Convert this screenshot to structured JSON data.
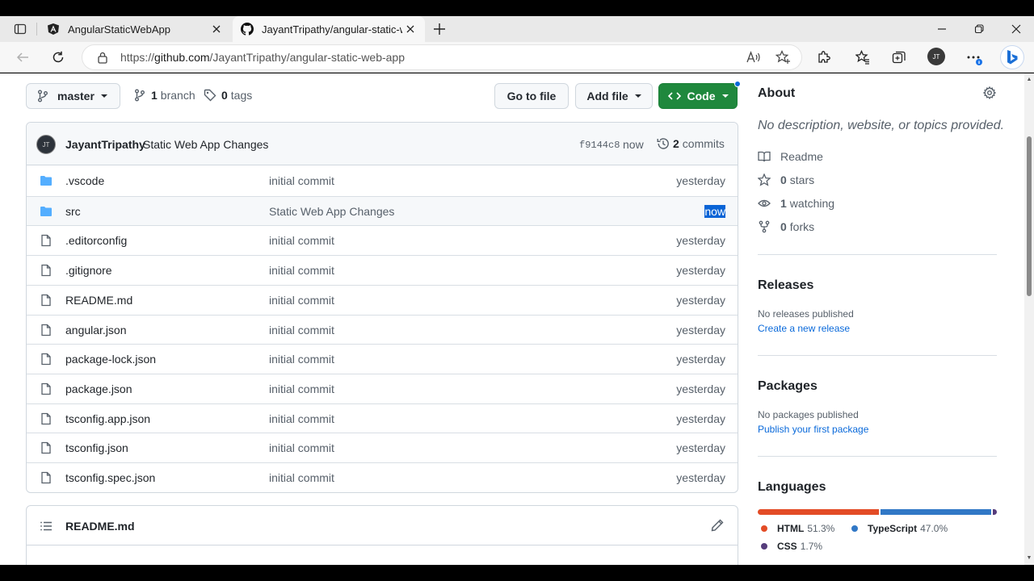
{
  "browser": {
    "tabs": [
      {
        "title": "AngularStaticWebApp",
        "favicon": "angular-icon",
        "active": false
      },
      {
        "title": "JayantTripathy/angular-static-web-app",
        "favicon": "github-icon",
        "active": true
      }
    ],
    "address": {
      "prefix": "https://",
      "host": "github.com",
      "path": "/JayantTripathy/angular-static-web-app"
    },
    "profile_initials": "JT"
  },
  "repo_bar": {
    "branch": "master",
    "branches_count": "1",
    "branches_label": "branch",
    "tags_count": "0",
    "tags_label": "tags",
    "goto_label": "Go to file",
    "addfile_label": "Add file",
    "code_label": "Code"
  },
  "commit": {
    "avatar_initials": "JT",
    "author": "JayantTripathy",
    "message": "Static Web App Changes",
    "sha": "f9144c8",
    "time": "now",
    "count": "2",
    "count_label": "commits"
  },
  "files": [
    {
      "type": "folder",
      "name": ".vscode",
      "message": "initial commit",
      "age": "yesterday"
    },
    {
      "type": "folder",
      "name": "src",
      "message": "Static Web App Changes",
      "age": "now"
    },
    {
      "type": "file",
      "name": ".editorconfig",
      "message": "initial commit",
      "age": "yesterday"
    },
    {
      "type": "file",
      "name": ".gitignore",
      "message": "initial commit",
      "age": "yesterday"
    },
    {
      "type": "file",
      "name": "README.md",
      "message": "initial commit",
      "age": "yesterday"
    },
    {
      "type": "file",
      "name": "angular.json",
      "message": "initial commit",
      "age": "yesterday"
    },
    {
      "type": "file",
      "name": "package-lock.json",
      "message": "initial commit",
      "age": "yesterday"
    },
    {
      "type": "file",
      "name": "package.json",
      "message": "initial commit",
      "age": "yesterday"
    },
    {
      "type": "file",
      "name": "tsconfig.app.json",
      "message": "initial commit",
      "age": "yesterday"
    },
    {
      "type": "file",
      "name": "tsconfig.json",
      "message": "initial commit",
      "age": "yesterday"
    },
    {
      "type": "file",
      "name": "tsconfig.spec.json",
      "message": "initial commit",
      "age": "yesterday"
    }
  ],
  "readme": {
    "title": "README.md"
  },
  "about": {
    "title": "About",
    "description": "No description, website, or topics provided.",
    "readme_label": "Readme",
    "stars_count": "0",
    "stars_label": "stars",
    "watching_count": "1",
    "watching_label": "watching",
    "forks_count": "0",
    "forks_label": "forks"
  },
  "releases": {
    "title": "Releases",
    "empty": "No releases published",
    "link": "Create a new release"
  },
  "packages": {
    "title": "Packages",
    "empty": "No packages published",
    "link": "Publish your first package"
  },
  "languages": {
    "title": "Languages",
    "items": [
      {
        "name": "HTML",
        "percent": "51.3%",
        "value": 51.3,
        "color": "#e34c26"
      },
      {
        "name": "TypeScript",
        "percent": "47.0%",
        "value": 47.0,
        "color": "#3178c6"
      },
      {
        "name": "CSS",
        "percent": "1.7%",
        "value": 1.7,
        "color": "#563d7c"
      }
    ]
  }
}
